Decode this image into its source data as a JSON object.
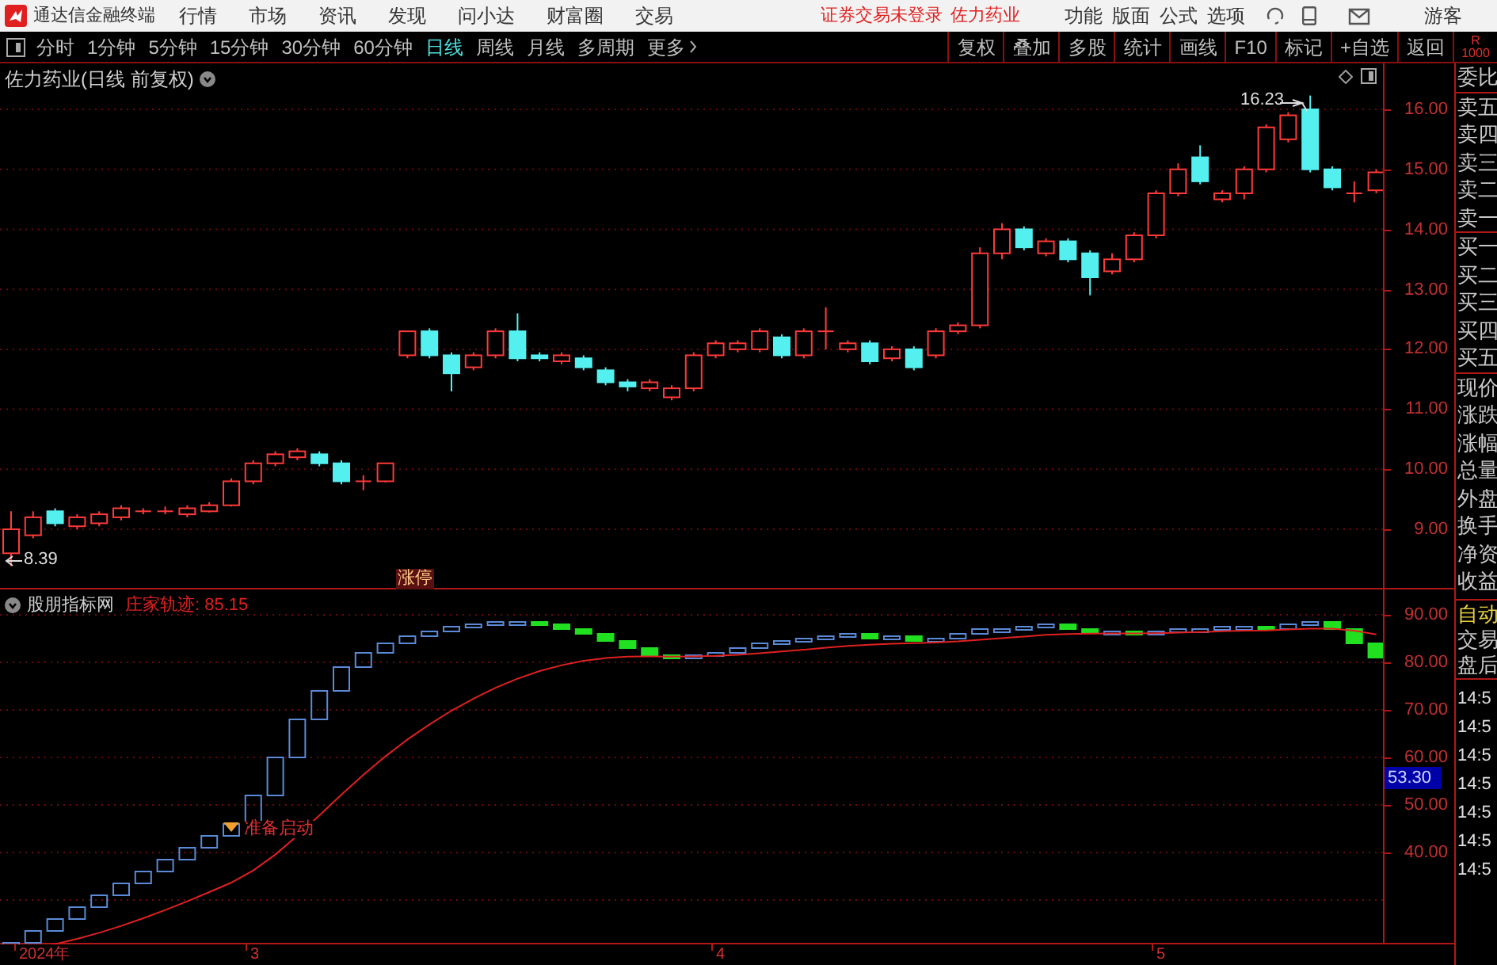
{
  "menu_bar": {
    "app_title": "通达信金融终端",
    "menus": [
      "行情",
      "市场",
      "资讯",
      "发现",
      "问小达",
      "财富圈",
      "交易"
    ],
    "notice": "证券交易未登录",
    "stock_link": "佐力药业",
    "right_menus": [
      "功能",
      "版面",
      "公式",
      "选项"
    ],
    "user": "游客"
  },
  "toolbar": {
    "periods": [
      {
        "label": "分时",
        "selected": false
      },
      {
        "label": "1分钟",
        "selected": false
      },
      {
        "label": "5分钟",
        "selected": false
      },
      {
        "label": "15分钟",
        "selected": false
      },
      {
        "label": "30分钟",
        "selected": false
      },
      {
        "label": "60分钟",
        "selected": false
      },
      {
        "label": "日线",
        "selected": true
      },
      {
        "label": "周线",
        "selected": false
      },
      {
        "label": "月线",
        "selected": false
      },
      {
        "label": "多周期",
        "selected": false
      }
    ],
    "more": "更多",
    "actions": [
      "复权",
      "叠加",
      "多股",
      "统计",
      "画线",
      "F10",
      "标记",
      "+自选",
      "返回"
    ]
  },
  "main_chart": {
    "title": "佐力药业(日线 前复权)",
    "price_ticks": [
      "16.00",
      "15.00",
      "14.00",
      "13.00",
      "12.00",
      "11.00",
      "10.00",
      "9.00"
    ],
    "high_marker": "16.23",
    "low_marker": "8.39",
    "limit_up_tag": "涨停"
  },
  "indicator": {
    "name": "股朋指标网",
    "series_label": "庄家轨迹: 85.15",
    "ticks": [
      "90.00",
      "80.00",
      "70.00",
      "60.00",
      "50.00",
      "40.00"
    ],
    "current_value": "53.30",
    "signal_label": "准备启动"
  },
  "date_axis": [
    "2024年",
    "3",
    "4",
    "5"
  ],
  "quote_panel": {
    "header": [
      "R",
      "1000"
    ],
    "groups": [
      [
        "委比"
      ],
      [
        "卖五",
        "卖四",
        "卖三",
        "卖二",
        "卖一"
      ],
      [
        "买一",
        "买二",
        "买三",
        "买四",
        "买五"
      ],
      [
        "现价",
        "涨跌",
        "涨幅",
        "总量",
        "外盘",
        "换手",
        "净资",
        "收益"
      ]
    ],
    "modes": [
      {
        "label": "自动",
        "active": true
      },
      {
        "label": "交易",
        "active": false
      },
      {
        "label": "盘后",
        "active": false
      }
    ],
    "times": [
      "14:5",
      "14:5",
      "14:5",
      "14:5",
      "14:5",
      "14:5",
      "14:5"
    ]
  }
}
